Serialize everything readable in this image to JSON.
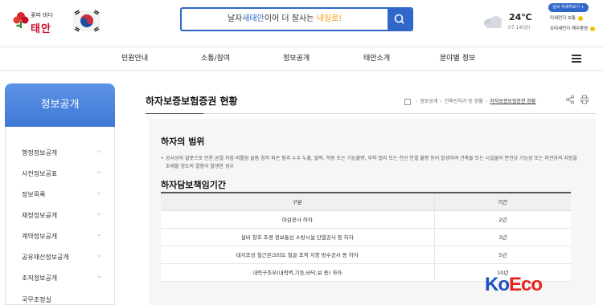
{
  "header": {
    "logo_line1": "꽃파 바다",
    "logo_line2": "태안",
    "search": {
      "prefix": "날자",
      "highlight": "새태안",
      "middle": "이어 더 잘사는",
      "highlight2": "내일로!",
      "suffix": ""
    },
    "weather": {
      "temperature": "24℃",
      "date": "07.14(금)",
      "detail_button": "날씨 자세히보기 +",
      "fine_dust_label": "미세먼지 보통",
      "ultra_dust_label": "초미세먼지 해우좋음"
    }
  },
  "nav": {
    "items": [
      "민원안내",
      "소통/참여",
      "정보공개",
      "태안소개",
      "분야별 정보"
    ]
  },
  "sidebar": {
    "title": "정보공개",
    "items": [
      {
        "label": "행정정보공개",
        "has_chevron": true
      },
      {
        "label": "사전정보공표",
        "has_chevron": true
      },
      {
        "label": "정보목록",
        "has_chevron": true
      },
      {
        "label": "재정정보공개",
        "has_chevron": true
      },
      {
        "label": "계약정보공개",
        "has_chevron": true
      },
      {
        "label": "공유재산정보공개",
        "has_chevron": true
      },
      {
        "label": "조직정보공개",
        "has_chevron": true
      },
      {
        "label": "국무조정실",
        "has_chevron": false
      }
    ]
  },
  "main": {
    "page_title": "하자보증보험증권 현황",
    "breadcrumb": [
      "정보공개",
      "건축인허가 등 현황",
      "하자보증보험증권 현황"
    ],
    "section1_title": "하자의 범위",
    "section1_bullet": "공사상의 잘못으로 인한 균열 처짐 비틀림 들뜸 침하 파손 붕괴 누수 누출, 탈락, 작동 또는 기능불량, 부착 접지 또는 전선 연결 불량 등이 발생하여 건축물 또는 시설물의 안전상 기능상 또는 미관상의 지장을 초래할 정도의 결함이 발생한 경우",
    "section2_title": "하자담보책임기간",
    "table": {
      "headers": [
        "구분",
        "기간"
      ],
      "rows": [
        [
          "마감공사 하자",
          "2년"
        ],
        [
          "설비 창호 조경 정보통신 소방시설 단열공사 등 하자",
          "3년"
        ],
        [
          "대지조성 철근콘크리트 철골 조적 지붕 방수공사 등 하자",
          "5년"
        ],
        [
          "내력구조부(내력벽,기둥,바닥,보 등) 하자",
          "10년"
        ]
      ]
    }
  },
  "watermark": {
    "text": "KoEco"
  },
  "colors": {
    "brand_blue": "#2f68c9",
    "sidebar_blue": "#4a84dc",
    "accent_orange": "#f29b0a",
    "watermark_blue": "#1f4fbf",
    "watermark_red": "#e8221c"
  }
}
